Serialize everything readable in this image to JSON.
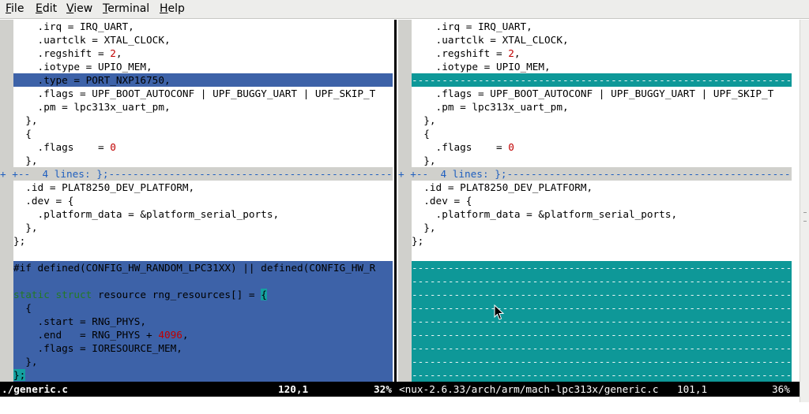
{
  "menu": [
    {
      "accel": "F",
      "rest": "ile"
    },
    {
      "accel": "E",
      "rest": "dit"
    },
    {
      "accel": "V",
      "rest": "iew"
    },
    {
      "accel": "T",
      "rest": "erminal"
    },
    {
      "accel": "H",
      "rest": "elp"
    }
  ],
  "fold_left": "+ +--  4 lines: };-------------------------------------------------------------------------------",
  "fold_right": "+ +--  4 lines: };-------------------------------------------------------------------------------",
  "lines": {
    "l0": "    .irq = IRQ_UART,",
    "l1": "    .uartclk = XTAL_CLOCK,",
    "l2a": "    .regshift = ",
    "l2b": "2",
    "l2c": ",",
    "l3": "    .iotype = UPIO_MEM,",
    "l4": "    .type = PORT_NXP16750,",
    "l5": "    .flags = UPF_BOOT_AUTOCONF | UPF_BUGGY_UART | UPF_SKIP_T",
    "l6": "    .pm = lpc313x_uart_pm,",
    "l7": "  },",
    "l8": "  {",
    "l9a": "    .flags    = ",
    "l9b": "0",
    "l10": "  },",
    "l12": "  .id = PLAT8250_DEV_PLATFORM,",
    "l13": "  .dev = {",
    "l14": "    .platform_data = &platform_serial_ports,",
    "l15": "  },",
    "l16": "};",
    "l18": "#if defined(CONFIG_HW_RANDOM_LPC31XX) || defined(CONFIG_HW_R",
    "l20a": "static struct",
    "l20b": " resource rng_resources[] = ",
    "l20c": "{",
    "l21": "  {",
    "l22": "    .start = RNG_PHYS,",
    "l23a": "    .end   = RNG_PHYS + ",
    "l23b": "4096",
    "l23c": ",",
    "l24": "    .flags = IORESOURCE_MEM,",
    "l25": "  },",
    "l26": "};"
  },
  "filler_text": "---------------------------------------------------------------------------------------------",
  "status": {
    "left_file": "./generic.c",
    "left_pos": "120,1",
    "left_pct": "32%",
    "right_file": "<nux-2.6.33/arch/arm/mach-lpc313x/generic.c",
    "right_pos": "101,1",
    "right_pct": "36%"
  },
  "colors": {
    "changed_bg": "#3d62a8",
    "filler_bg": "#0e9898",
    "fold_bg": "#d0d0cc",
    "number": "#c00000",
    "keyword": "#247a24"
  }
}
